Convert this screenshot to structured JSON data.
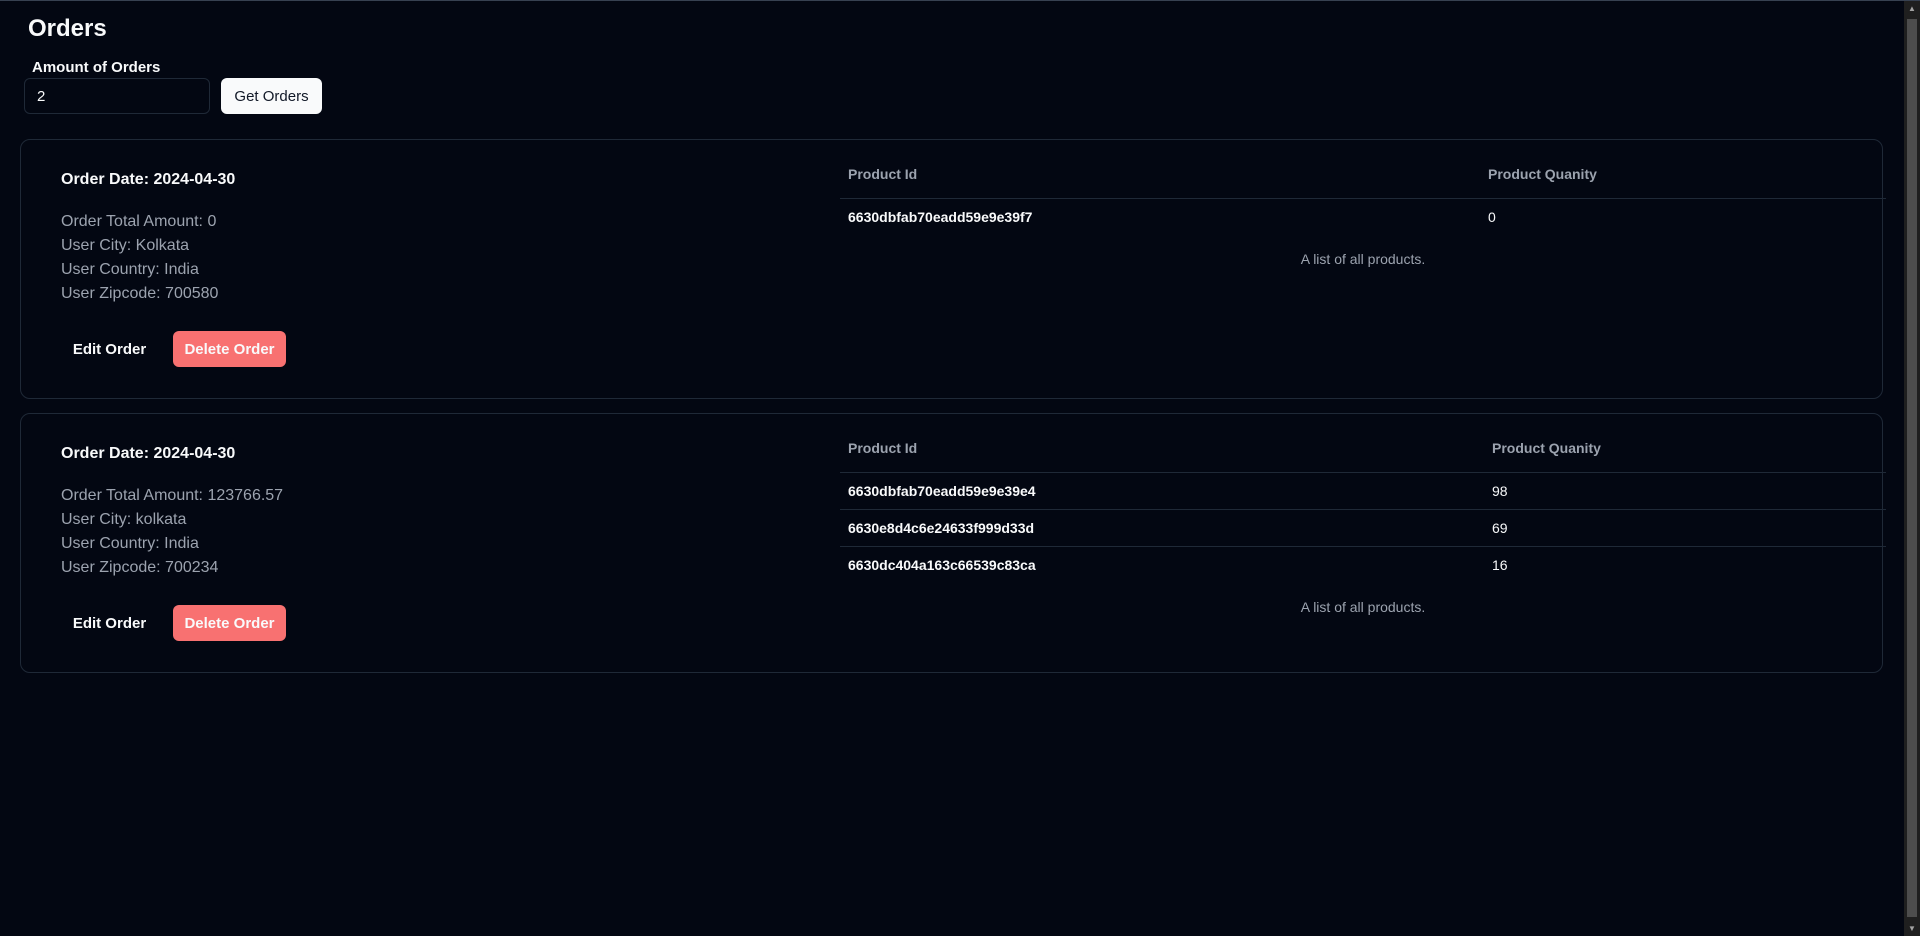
{
  "page": {
    "title": "Orders"
  },
  "controls": {
    "amount_label": "Amount of Orders",
    "amount_value": "2",
    "get_button": "Get Orders"
  },
  "orders": [
    {
      "date_label": "Order Date: 2024-04-30",
      "total": "Order Total Amount: 0",
      "city": "User City: Kolkata",
      "country": "User Country: India",
      "zipcode": "User Zipcode: 700580",
      "edit_label": "Edit Order",
      "delete_label": "Delete Order",
      "table": {
        "headers": [
          "Product Id",
          "Product Quanity"
        ],
        "rows": [
          {
            "id": "6630dbfab70eadd59e9e39f7",
            "qty": "0"
          }
        ],
        "caption": "A list of all products."
      }
    },
    {
      "date_label": "Order Date: 2024-04-30",
      "total": "Order Total Amount: 123766.57",
      "city": "User City: kolkata",
      "country": "User Country: India",
      "zipcode": "User Zipcode: 700234",
      "edit_label": "Edit Order",
      "delete_label": "Delete Order",
      "table": {
        "headers": [
          "Product Id",
          "Product Quanity"
        ],
        "rows": [
          {
            "id": "6630dbfab70eadd59e9e39e4",
            "qty": "98"
          },
          {
            "id": "6630e8d4c6e24633f999d33d",
            "qty": "69"
          },
          {
            "id": "6630dc404a163c66539c83ca",
            "qty": "16"
          }
        ],
        "caption": "A list of all products."
      }
    }
  ],
  "colors": {
    "background": "#030712",
    "danger": "#f87171",
    "muted_text": "#9ca3af",
    "border": "#1f2937"
  }
}
